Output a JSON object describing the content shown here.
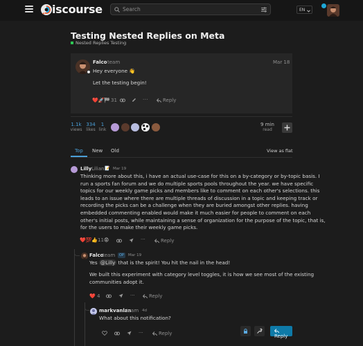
{
  "header": {
    "logo_text": "iscourse",
    "search_placeholder": "Search",
    "language": "EN"
  },
  "topic": {
    "title": "Testing Nested Replies on Meta",
    "category": "Nested Replies Testing",
    "category_color": "#2ec754"
  },
  "first_post": {
    "author": "Falco",
    "role": "team",
    "date": "Mar 18",
    "greeting": "Hey everyone 👋",
    "body": "Let the testing begin!",
    "reaction_count": "31",
    "reply_label": "Reply"
  },
  "stats": {
    "views_n": "1.1k",
    "views_l": "views",
    "likes_n": "334",
    "likes_l": "likes",
    "link_n": "1",
    "link_l": "link",
    "read_n": "9 min",
    "read_l": "read"
  },
  "tabs": {
    "top": "Top",
    "new": "New",
    "old": "Old",
    "view_flat": "View as flat"
  },
  "posts": [
    {
      "author": "Lilly",
      "subname": "Lilian",
      "date": "Mar 19",
      "lines": [
        "Thinking more about this, i have an actual use-case for this on a by-category or by-topic basis. I",
        "run a sports fan forum and we do multiple sports pools throughout the year. we have specific",
        "topics for our weekly game picks and members like to comment on each other's selections. this",
        "leads to an issue where there are multiple threads of discussion in a topic and keeping track or",
        "recording the picks can be a challenge when they are buried amongst other replies. having",
        "embedded commenting enabled would make it much easier for people to comment on each",
        "other's initial posts, while maintaining a sense of organization for the purpose of the topic, that is,",
        "for the users to make their weekly game picks."
      ],
      "reaction_count": "11",
      "reply_label": "Reply"
    },
    {
      "author": "Falco",
      "role": "team",
      "badge": "OP",
      "date": "Mar 19",
      "line1_pre": "Yes",
      "mention": "@Lilly",
      "line1_post": "that is the spirit! You hit the nail in the head!",
      "para2_l1": "We built this experiment with category level toggles, it is how we see most of the existing",
      "para2_l2": "communities adopt it.",
      "reaction_count": "4",
      "reply_label": "Reply"
    },
    {
      "author": "markvanlan",
      "role": "team",
      "date": "4d",
      "body": "What about this notification?",
      "reply_label": "Reply"
    }
  ],
  "reply_button": "Reply"
}
